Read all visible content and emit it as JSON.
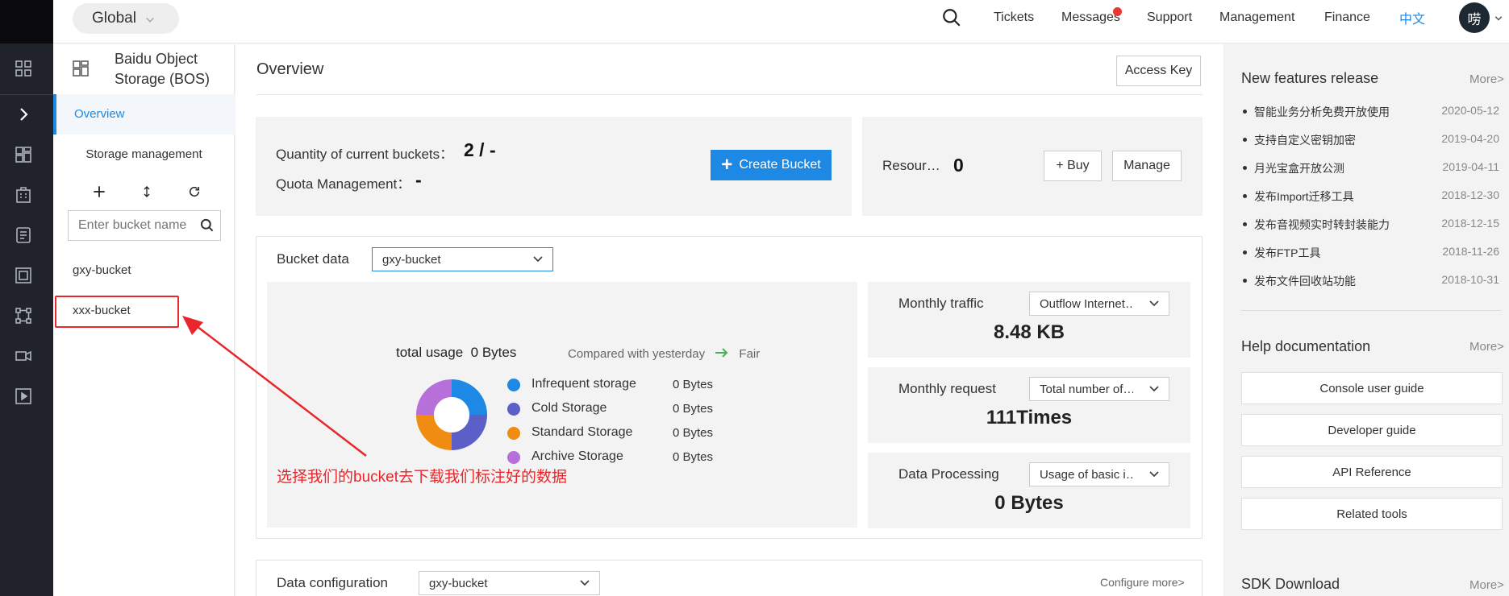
{
  "header": {
    "region": "Global",
    "nav": [
      "Tickets",
      "Messages",
      "Support",
      "Management",
      "Finance",
      "中文"
    ],
    "avatar": "唠",
    "lang_color": "#1e88e5"
  },
  "sidebar": {
    "title": "Baidu Object Storage (BOS)",
    "overview": "Overview",
    "storage_management": "Storage management",
    "search_placeholder": "Enter bucket name",
    "buckets": [
      "gxy-bucket",
      "xxx-bucket"
    ]
  },
  "main": {
    "title": "Overview",
    "access_key": "Access Key",
    "quantity_label": "Quantity of current buckets：",
    "quantity_value": "2 / -",
    "quota_label": "Quota Management：",
    "quota_value": "-",
    "create_bucket": "Create Bucket",
    "resource_label": "Resour…",
    "resource_value": "0",
    "buy": "+ Buy",
    "manage": "Manage",
    "bucket_data_label": "Bucket data",
    "bucket_data_select": "gxy-bucket",
    "total_usage_label": "total usage",
    "total_usage_value": "0 Bytes",
    "compared_label": "Compared with yesterday",
    "compared_value": "Fair",
    "storage_legend": [
      {
        "name": "Infrequent storage",
        "value": "0 Bytes",
        "color": "#1e88e5"
      },
      {
        "name": "Cold Storage",
        "value": "0 Bytes",
        "color": "#5b5fc7"
      },
      {
        "name": "Standard Storage",
        "value": "0 Bytes",
        "color": "#f08c12"
      },
      {
        "name": "Archive Storage",
        "value": "0 Bytes",
        "color": "#b76fd9"
      }
    ],
    "metrics": [
      {
        "title": "Monthly traffic",
        "select": "Outflow Internet…",
        "value": "8.48 KB"
      },
      {
        "title": "Monthly request",
        "select": "Total number of…",
        "value": "111Times"
      },
      {
        "title": "Data Processing",
        "select": "Usage of basic i…",
        "value": "0 Bytes"
      }
    ],
    "data_config_label": "Data configuration",
    "data_config_select": "gxy-bucket",
    "configure_more": "Configure more>",
    "annotation": "选择我们的bucket去下载我们标注好的数据"
  },
  "right": {
    "new_features_title": "New features release",
    "more": "More>",
    "news": [
      {
        "title": "智能业务分析免费开放使用",
        "date": "2020-05-12"
      },
      {
        "title": "支持自定义密钥加密",
        "date": "2019-04-20"
      },
      {
        "title": "月光宝盒开放公测",
        "date": "2019-04-11"
      },
      {
        "title": "发布Import迁移工具",
        "date": "2018-12-30"
      },
      {
        "title": "发布音视频实时转封装能力",
        "date": "2018-12-15"
      },
      {
        "title": "发布FTP工具",
        "date": "2018-11-26"
      },
      {
        "title": "发布文件回收站功能",
        "date": "2018-10-31"
      }
    ],
    "help_title": "Help documentation",
    "docs": [
      "Console user guide",
      "Developer guide",
      "API Reference",
      "Related tools"
    ],
    "sdk_title": "SDK Download"
  }
}
